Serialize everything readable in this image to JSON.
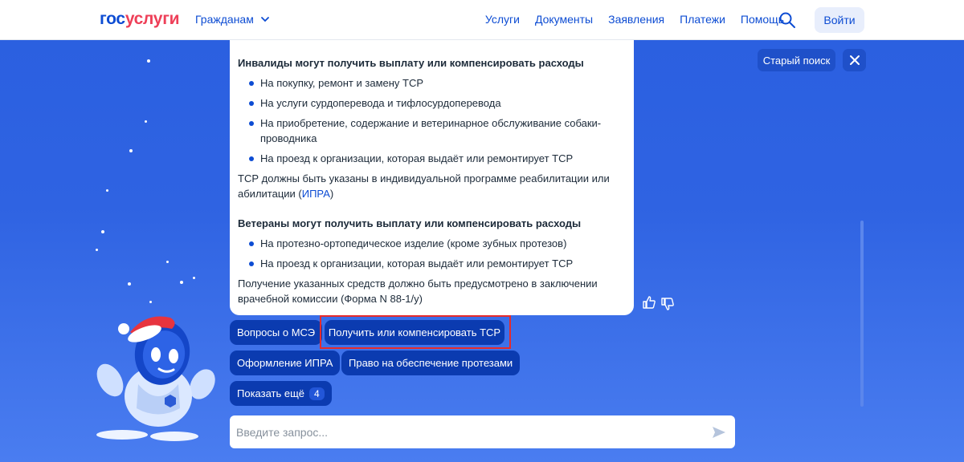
{
  "header": {
    "logo_part1": "гос",
    "logo_part2": "услуги",
    "audience": "Гражданам",
    "nav": [
      "Услуги",
      "Документы",
      "Заявления",
      "Платежи",
      "Помощь"
    ],
    "login": "Войти"
  },
  "controls": {
    "old_search": "Старый поиск"
  },
  "answer": {
    "section1_title": "Инвалиды могут получить выплату или компенсировать расходы",
    "section1_items": [
      "На покупку, ремонт и замену ТСР",
      "На услуги сурдоперевода и тифлосурдоперевода",
      "На приобретение, содержание и ветеринарное обслуживание собаки-проводника",
      "На проезд к организации, которая выдаёт или ремонтирует ТСР"
    ],
    "section1_note_before": "ТСР должны быть указаны в индивидуальной программе реабилитации или абилитации (",
    "section1_note_link": "ИПРА",
    "section1_note_after": ")",
    "section2_title": "Ветераны могут получить выплату или компенсировать расходы",
    "section2_items": [
      "На протезно-ортопедическое изделие (кроме зубных протезов)",
      "На проезд к организации, которая выдаёт или ремонтирует ТСР"
    ],
    "section2_note": "Получение указанных средств должно быть предусмотрено в заключении врачебной комиссии (Форма N 88-1/у)"
  },
  "chips": {
    "c1": "Вопросы о МСЭ",
    "c2": "Получить или компенсировать ТСР",
    "c3": "Оформление ИПРА",
    "c4": "Право на обеспечение протезами",
    "more": "Показать ещё",
    "more_count": "4"
  },
  "input": {
    "placeholder": "Введите запрос..."
  },
  "colors": {
    "brand_blue": "#0d4cd3",
    "brand_red": "#ee3f58",
    "chip_bg": "#0b3bb0",
    "highlight": "#e62b2b"
  }
}
